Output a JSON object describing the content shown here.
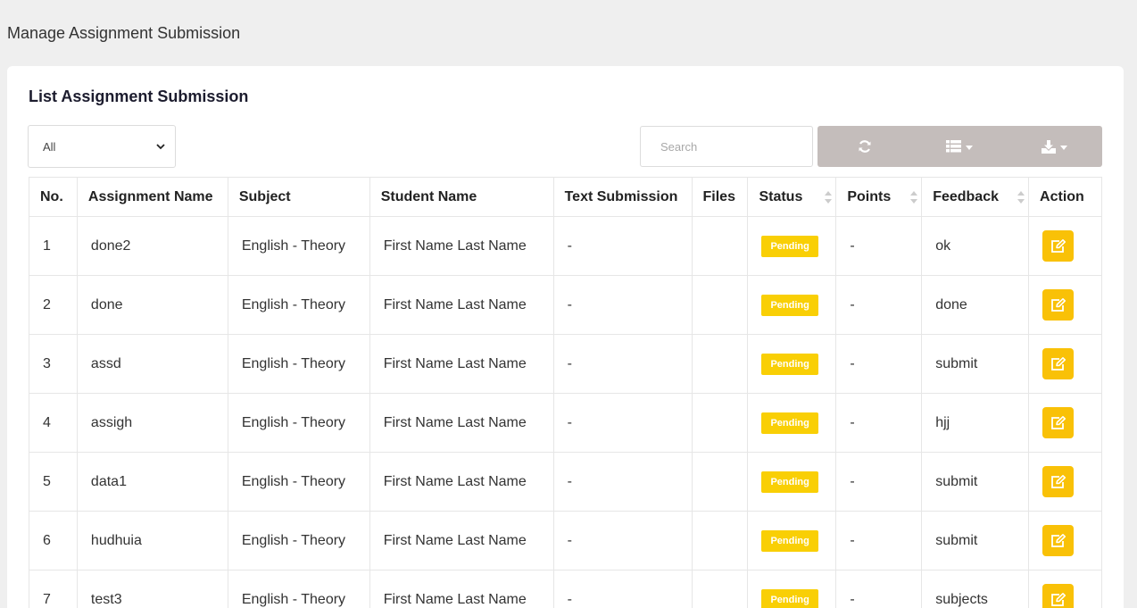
{
  "header": {
    "title": "Manage Assignment Submission"
  },
  "card": {
    "title": "List Assignment Submission"
  },
  "filter": {
    "selected": "All"
  },
  "search": {
    "placeholder": "Search"
  },
  "toolbar": {
    "icons": [
      "refresh-icon",
      "columns-icon",
      "export-icon"
    ]
  },
  "table": {
    "headers": {
      "no": "No.",
      "assignment": "Assignment Name",
      "subject": "Subject",
      "student": "Student Name",
      "text": "Text Submission",
      "files": "Files",
      "status": "Status",
      "points": "Points",
      "feedback": "Feedback",
      "action": "Action"
    },
    "rows": [
      {
        "no": "1",
        "assignment": "done2",
        "subject": "English - Theory",
        "student": "First Name Last Name",
        "text": "-",
        "files": "",
        "status": "Pending",
        "points": "-",
        "feedback": "ok"
      },
      {
        "no": "2",
        "assignment": "done",
        "subject": "English - Theory",
        "student": "First Name Last Name",
        "text": "-",
        "files": "",
        "status": "Pending",
        "points": "-",
        "feedback": "done"
      },
      {
        "no": "3",
        "assignment": "assd",
        "subject": "English - Theory",
        "student": "First Name Last Name",
        "text": "-",
        "files": "",
        "status": "Pending",
        "points": "-",
        "feedback": "submit"
      },
      {
        "no": "4",
        "assignment": "assigh",
        "subject": "English - Theory",
        "student": "First Name Last Name",
        "text": "-",
        "files": "",
        "status": "Pending",
        "points": "-",
        "feedback": "hjj"
      },
      {
        "no": "5",
        "assignment": "data1",
        "subject": "English - Theory",
        "student": "First Name Last Name",
        "text": "-",
        "files": "",
        "status": "Pending",
        "points": "-",
        "feedback": "submit"
      },
      {
        "no": "6",
        "assignment": "hudhuia",
        "subject": "English - Theory",
        "student": "First Name Last Name",
        "text": "-",
        "files": "",
        "status": "Pending",
        "points": "-",
        "feedback": "submit"
      },
      {
        "no": "7",
        "assignment": "test3",
        "subject": "English - Theory",
        "student": "First Name Last Name",
        "text": "-",
        "files": "",
        "status": "Pending",
        "points": "-",
        "feedback": "subjects"
      }
    ]
  },
  "colors": {
    "badge": "#f9cf05",
    "edit": "#f9c107",
    "toolbar": "#c4bdbb"
  }
}
